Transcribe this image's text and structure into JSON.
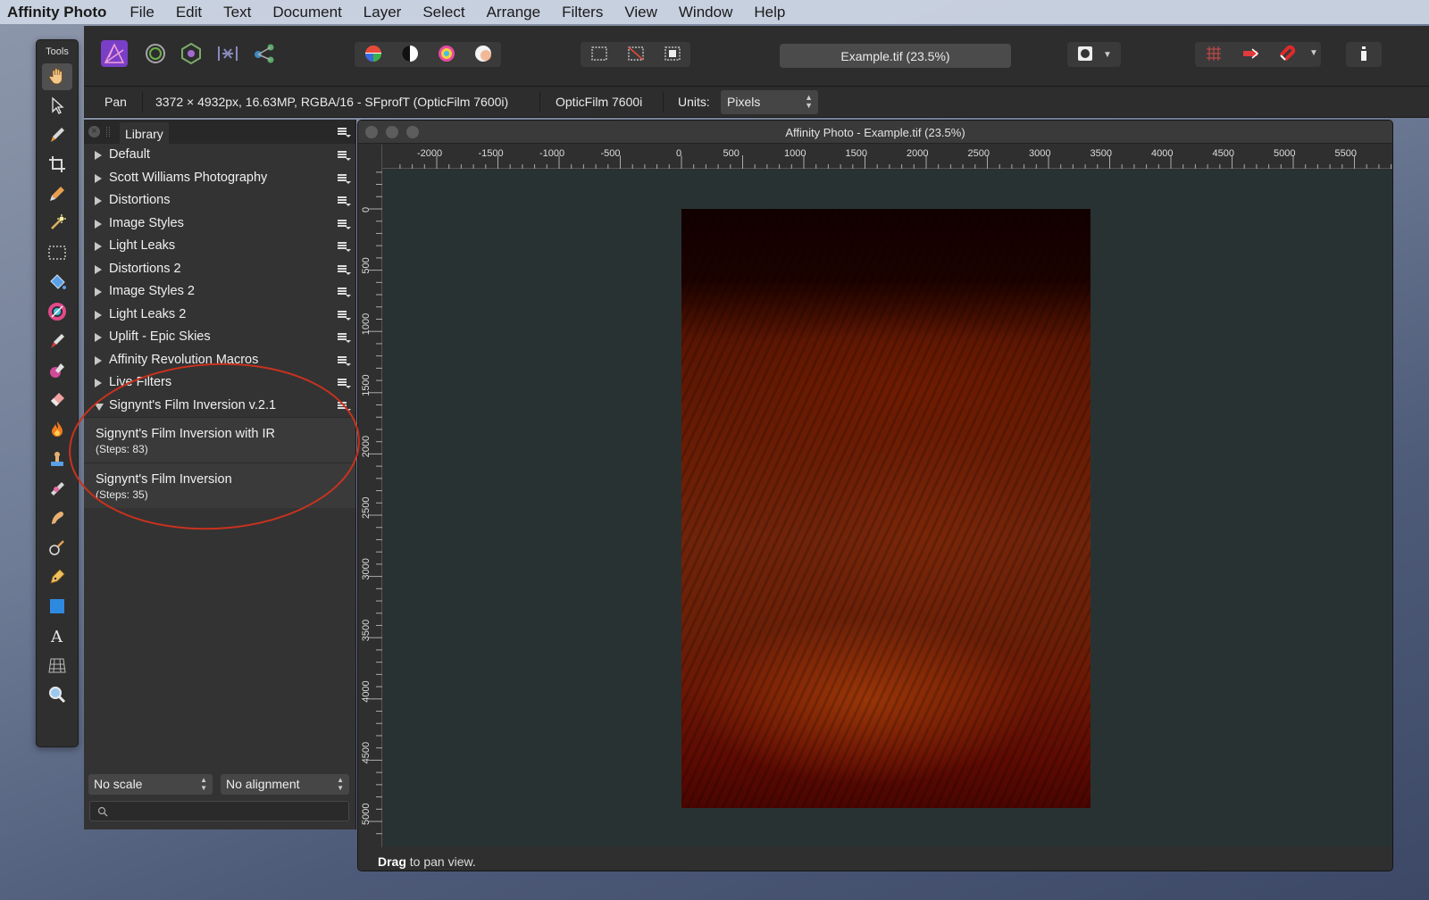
{
  "menubar": {
    "app_name": "Affinity Photo",
    "items": [
      "File",
      "Edit",
      "Text",
      "Document",
      "Layer",
      "Select",
      "Arrange",
      "Filters",
      "View",
      "Window",
      "Help"
    ]
  },
  "tools": {
    "title": "Tools",
    "items": [
      "hand-icon",
      "move-icon",
      "brush-selection-icon",
      "crop-icon",
      "color-picker-icon",
      "flood-select-icon",
      "marquee-icon",
      "fill-icon",
      "gradient-icon",
      "paint-brush-icon",
      "color-replace-icon",
      "erase-icon",
      "burn-icon",
      "clone-icon",
      "healing-icon",
      "smudge-icon",
      "retouch-icon",
      "pen-icon",
      "shape-icon",
      "text-icon",
      "mesh-warp-icon",
      "zoom-icon"
    ]
  },
  "toolbar": {
    "document_title": "Example.tif (23.5%)"
  },
  "context": {
    "tool_name": "Pan",
    "doc_info": "3372 × 4932px, 16.63MP, RGBA/16 - SFprofT (OpticFilm 7600i)",
    "profile": "OpticFilm 7600i",
    "units_label": "Units:",
    "units_value": "Pixels"
  },
  "library": {
    "tab_label": "Library",
    "categories": [
      {
        "label": "Default",
        "open": false
      },
      {
        "label": "Scott Williams Photography",
        "open": false
      },
      {
        "label": "Distortions",
        "open": false
      },
      {
        "label": "Image Styles",
        "open": false
      },
      {
        "label": "Light Leaks",
        "open": false
      },
      {
        "label": "Distortions 2",
        "open": false
      },
      {
        "label": "Image Styles 2",
        "open": false
      },
      {
        "label": "Light Leaks 2",
        "open": false
      },
      {
        "label": "Uplift - Epic Skies",
        "open": false
      },
      {
        "label": "Affinity Revolution Macros",
        "open": false
      },
      {
        "label": "Live Filters",
        "open": false
      },
      {
        "label": "Signynt's Film Inversion v.2.1",
        "open": true
      }
    ],
    "macros": [
      {
        "name": "Signynt's Film Inversion with IR",
        "steps": "(Steps: 83)"
      },
      {
        "name": "Signynt's Film Inversion",
        "steps": "(Steps: 35)"
      }
    ],
    "scale_select": "No scale",
    "alignment_select": "No alignment",
    "search_placeholder": ""
  },
  "document": {
    "window_title": "Affinity Photo - Example.tif (23.5%)",
    "ruler_unit": "px",
    "h_ruler_labels": [
      "-2000",
      "-1500",
      "-1000",
      "-500",
      "0",
      "500",
      "1000",
      "1500",
      "2000",
      "2500",
      "3000",
      "3500",
      "4000",
      "4500",
      "5000",
      "5500"
    ],
    "v_ruler_labels": [
      "0",
      "500",
      "1000",
      "1500",
      "2000",
      "2500",
      "3000",
      "3500",
      "4000",
      "4500",
      "5000"
    ],
    "status_bold": "Drag",
    "status_rest": " to pan view."
  },
  "colors": {
    "annotation": "#c8321e",
    "canvas": "#283233",
    "panel": "#333333"
  }
}
